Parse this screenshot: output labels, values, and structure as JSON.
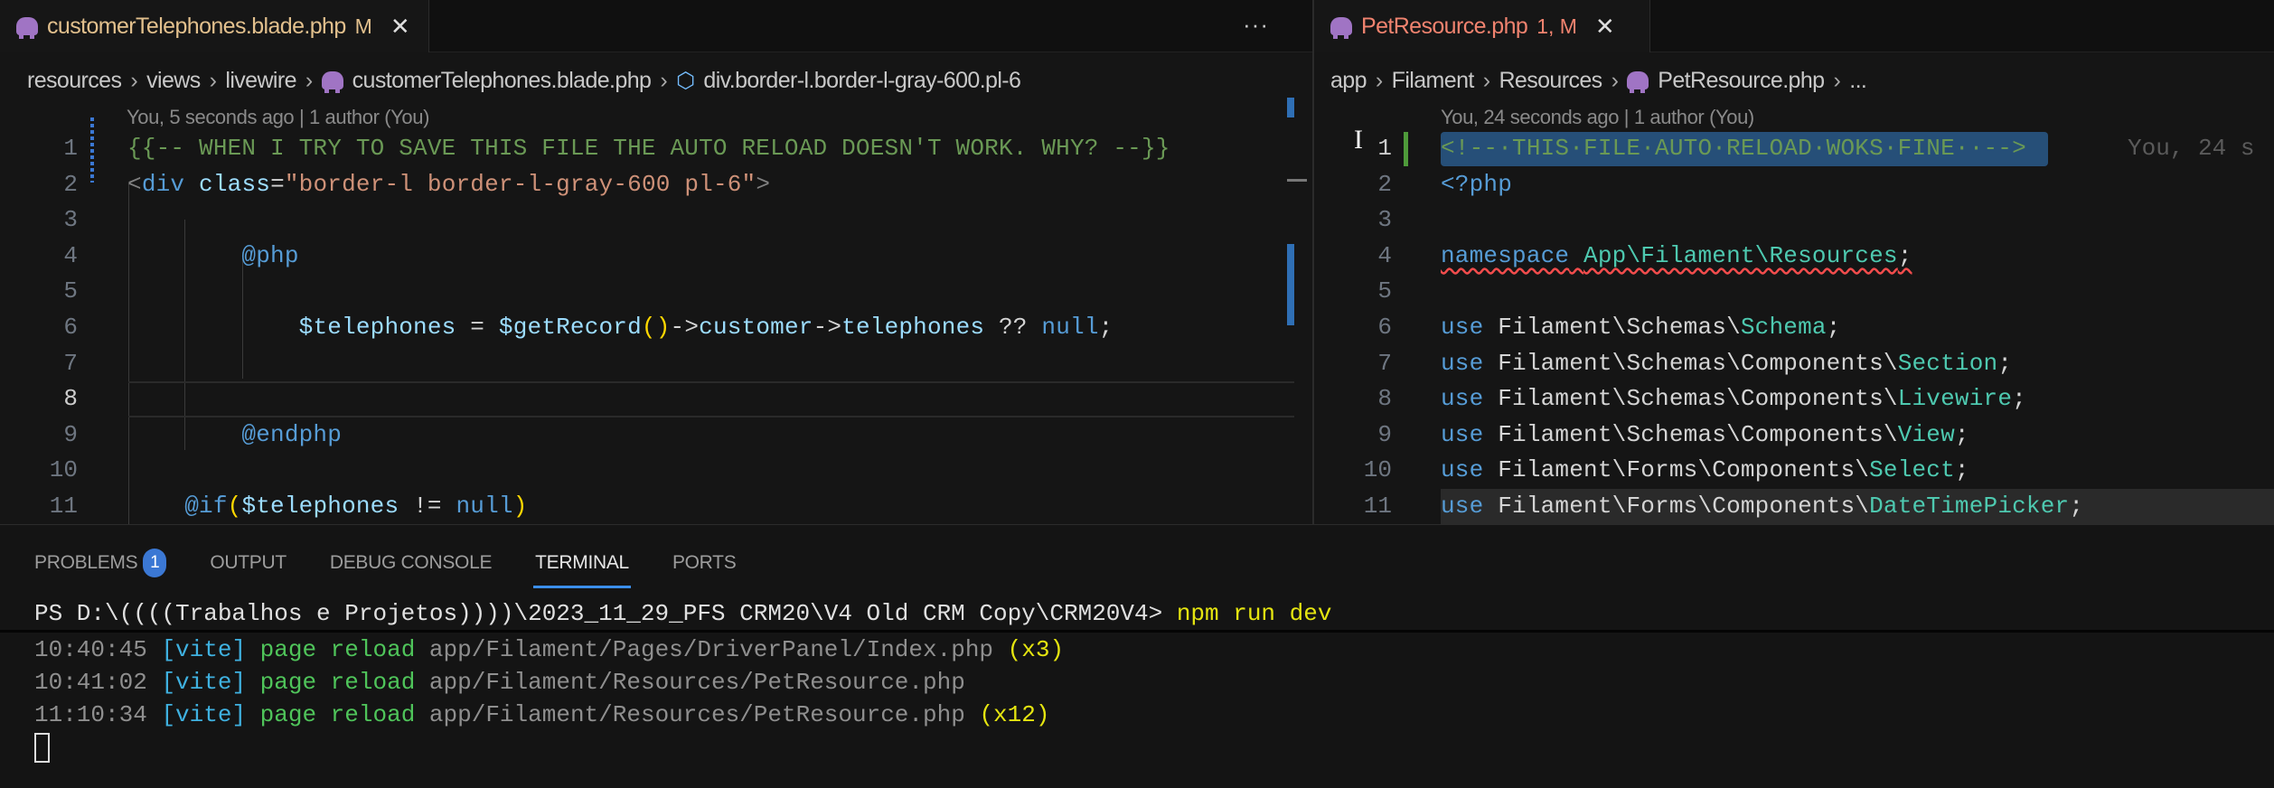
{
  "left_editor": {
    "tab": {
      "name": "customerTelephones.blade.php",
      "status": "M",
      "close": "✕"
    },
    "more_actions": "···",
    "breadcrumb": [
      "resources",
      "views",
      "livewire",
      "customerTelephones.blade.php",
      "div.border-l.border-l-gray-600.pl-6"
    ],
    "blame": "You, 5 seconds ago | 1 author (You)",
    "active_line": 8,
    "lines": [
      [
        [
          "{{-- WHEN I TRY TO SAVE THIS FILE THE AUTO RELOAD DOESN'T WORK. WHY? --}}",
          "cm"
        ]
      ],
      [
        [
          "<",
          "pu"
        ],
        [
          "div",
          "tg"
        ],
        [
          " ",
          "t"
        ],
        [
          "class",
          "at"
        ],
        [
          "=",
          "t"
        ],
        [
          "\"border-l border-l-gray-600 pl-6\"",
          "st"
        ],
        [
          ">",
          "pu"
        ]
      ],
      [],
      [
        [
          "        ",
          "t"
        ],
        [
          "@php",
          "kw"
        ]
      ],
      [],
      [
        [
          "            ",
          "t"
        ],
        [
          "$telephones",
          "vr"
        ],
        [
          " = ",
          "t"
        ],
        [
          "$getRecord",
          "vr"
        ],
        [
          "()",
          "br"
        ],
        [
          "->",
          "t"
        ],
        [
          "customer",
          "vr"
        ],
        [
          "->",
          "t"
        ],
        [
          "telephones",
          "vr"
        ],
        [
          " ?? ",
          "t"
        ],
        [
          "null",
          "kw"
        ],
        [
          ";",
          "t"
        ]
      ],
      [],
      [],
      [
        [
          "        ",
          "t"
        ],
        [
          "@endphp",
          "kw"
        ]
      ],
      [],
      [
        [
          "    ",
          "t"
        ],
        [
          "@if",
          "kw"
        ],
        [
          "(",
          "br"
        ],
        [
          "$telephones",
          "vr"
        ],
        [
          " != ",
          "t"
        ],
        [
          "null",
          "kw"
        ],
        [
          ")",
          "br"
        ]
      ]
    ]
  },
  "right_editor": {
    "tab": {
      "name": "PetResource.php",
      "status": "1, M",
      "close": "✕"
    },
    "breadcrumb": [
      "app",
      "Filament",
      "Resources",
      "PetResource.php",
      "..."
    ],
    "blame": "You, 24 seconds ago | 1 author (You)",
    "inline_blame": "You, 24 s",
    "active_line": 1,
    "lines": [
      [
        [
          "<!--·THIS·FILE·AUTO·RELOAD·WOKS·FINE··-->",
          "cm"
        ]
      ],
      [
        [
          "<?php",
          "kw"
        ]
      ],
      [],
      [
        [
          "namespace",
          "kw"
        ],
        [
          " ",
          "t"
        ],
        [
          "App\\Filament\\Resources",
          "ty"
        ],
        [
          ";",
          "t"
        ]
      ],
      [],
      [
        [
          "use",
          "kw"
        ],
        [
          " Filament\\Schemas\\",
          "t"
        ],
        [
          "Schema",
          "ty"
        ],
        [
          ";",
          "t"
        ]
      ],
      [
        [
          "use",
          "kw"
        ],
        [
          " Filament\\Schemas\\Components\\",
          "t"
        ],
        [
          "Section",
          "ty"
        ],
        [
          ";",
          "t"
        ]
      ],
      [
        [
          "use",
          "kw"
        ],
        [
          " Filament\\Schemas\\Components\\",
          "t"
        ],
        [
          "Livewire",
          "ty"
        ],
        [
          ";",
          "t"
        ]
      ],
      [
        [
          "use",
          "kw"
        ],
        [
          " Filament\\Schemas\\Components\\",
          "t"
        ],
        [
          "View",
          "ty"
        ],
        [
          ";",
          "t"
        ]
      ],
      [
        [
          "use",
          "kw"
        ],
        [
          " Filament\\Forms\\Components\\",
          "t"
        ],
        [
          "Select",
          "ty"
        ],
        [
          ";",
          "t"
        ]
      ],
      [
        [
          "use",
          "kw"
        ],
        [
          " Filament\\Forms\\Components\\",
          "t"
        ],
        [
          "DateTimePicker",
          "ty"
        ],
        [
          ";",
          "t"
        ]
      ]
    ]
  },
  "panel": {
    "tabs": [
      {
        "label": "PROBLEMS",
        "badge": "1"
      },
      {
        "label": "OUTPUT"
      },
      {
        "label": "DEBUG CONSOLE"
      },
      {
        "label": "TERMINAL",
        "active": true
      },
      {
        "label": "PORTS"
      }
    ],
    "terminal": {
      "prompt": "PS D:\\((((Trabalhos e Projetos))))\\2023_11_29_PFS CRM20\\V4 Old CRM Copy\\CRM20V4>",
      "command": "npm run dev",
      "log": [
        {
          "time": "10:40:45",
          "tag": "[vite]",
          "msg": "page reload",
          "path": "app/Filament/Pages/DriverPanel/Index.php",
          "count": "(x3)"
        },
        {
          "time": "10:41:02",
          "tag": "[vite]",
          "msg": "page reload",
          "path": "app/Filament/Resources/PetResource.php",
          "count": ""
        },
        {
          "time": "11:10:34",
          "tag": "[vite]",
          "msg": "page reload",
          "path": "app/Filament/Resources/PetResource.php",
          "count": "(x12)"
        }
      ]
    }
  },
  "colors": {
    "accent": "#3b8eea",
    "selection": "#264f78",
    "comment": "#6a9955",
    "keyword": "#569cd6"
  }
}
